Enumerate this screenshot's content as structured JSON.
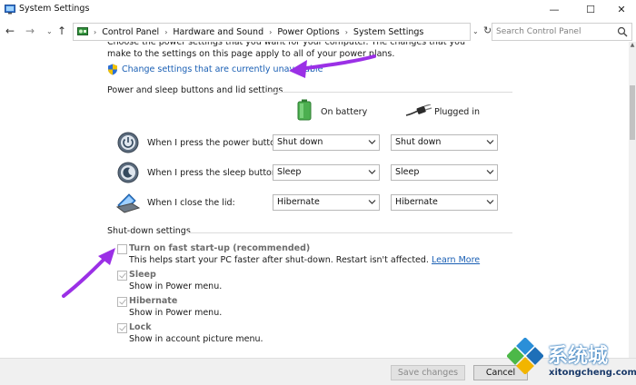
{
  "window": {
    "title": "System Settings",
    "minimize": "—",
    "maximize": "☐",
    "close": "✕"
  },
  "address": {
    "back": "←",
    "forward": "→",
    "recent": "⌄",
    "up": "↑",
    "crumbs": [
      "Control Panel",
      "Hardware and Sound",
      "Power Options",
      "System Settings"
    ],
    "separator": "›",
    "dropdown": "⌄",
    "refresh": "↻",
    "search_placeholder": "Search Control Panel"
  },
  "intro": {
    "text": "Choose the power settings that you want for your computer. The changes that you make to the settings on this page apply to all of your power plans.",
    "change_link": "Change settings that are currently unavailable"
  },
  "buttons_section": {
    "title": "Power and sleep buttons and lid settings",
    "col_battery": "On battery",
    "col_plugged": "Plugged in",
    "rows": [
      {
        "label": "When I press the power button:",
        "battery": "Shut down",
        "plugged": "Shut down",
        "icon": "power-button-icon"
      },
      {
        "label": "When I press the sleep button:",
        "battery": "Sleep",
        "plugged": "Sleep",
        "icon": "sleep-button-icon"
      },
      {
        "label": "When I close the lid:",
        "battery": "Hibernate",
        "plugged": "Hibernate",
        "icon": "laptop-lid-icon"
      }
    ]
  },
  "shutdown_section": {
    "title": "Shut-down settings",
    "options": [
      {
        "label": "Turn on fast start-up (recommended)",
        "desc": "This helps start your PC faster after shut-down. Restart isn't affected.",
        "link": "Learn More",
        "checked": false
      },
      {
        "label": "Sleep",
        "desc": "Show in Power menu.",
        "checked": true
      },
      {
        "label": "Hibernate",
        "desc": "Show in Power menu.",
        "checked": true
      },
      {
        "label": "Lock",
        "desc": "Show in account picture menu.",
        "checked": true
      }
    ]
  },
  "footer": {
    "save": "Save changes",
    "cancel": "Cancel"
  },
  "watermark": {
    "cn": "系统城",
    "en": "xitongcheng.com"
  },
  "colors": {
    "link": "#1a5fb4",
    "annotation_arrow": "#9b30e6",
    "disabled_text": "#6d6d6d"
  }
}
